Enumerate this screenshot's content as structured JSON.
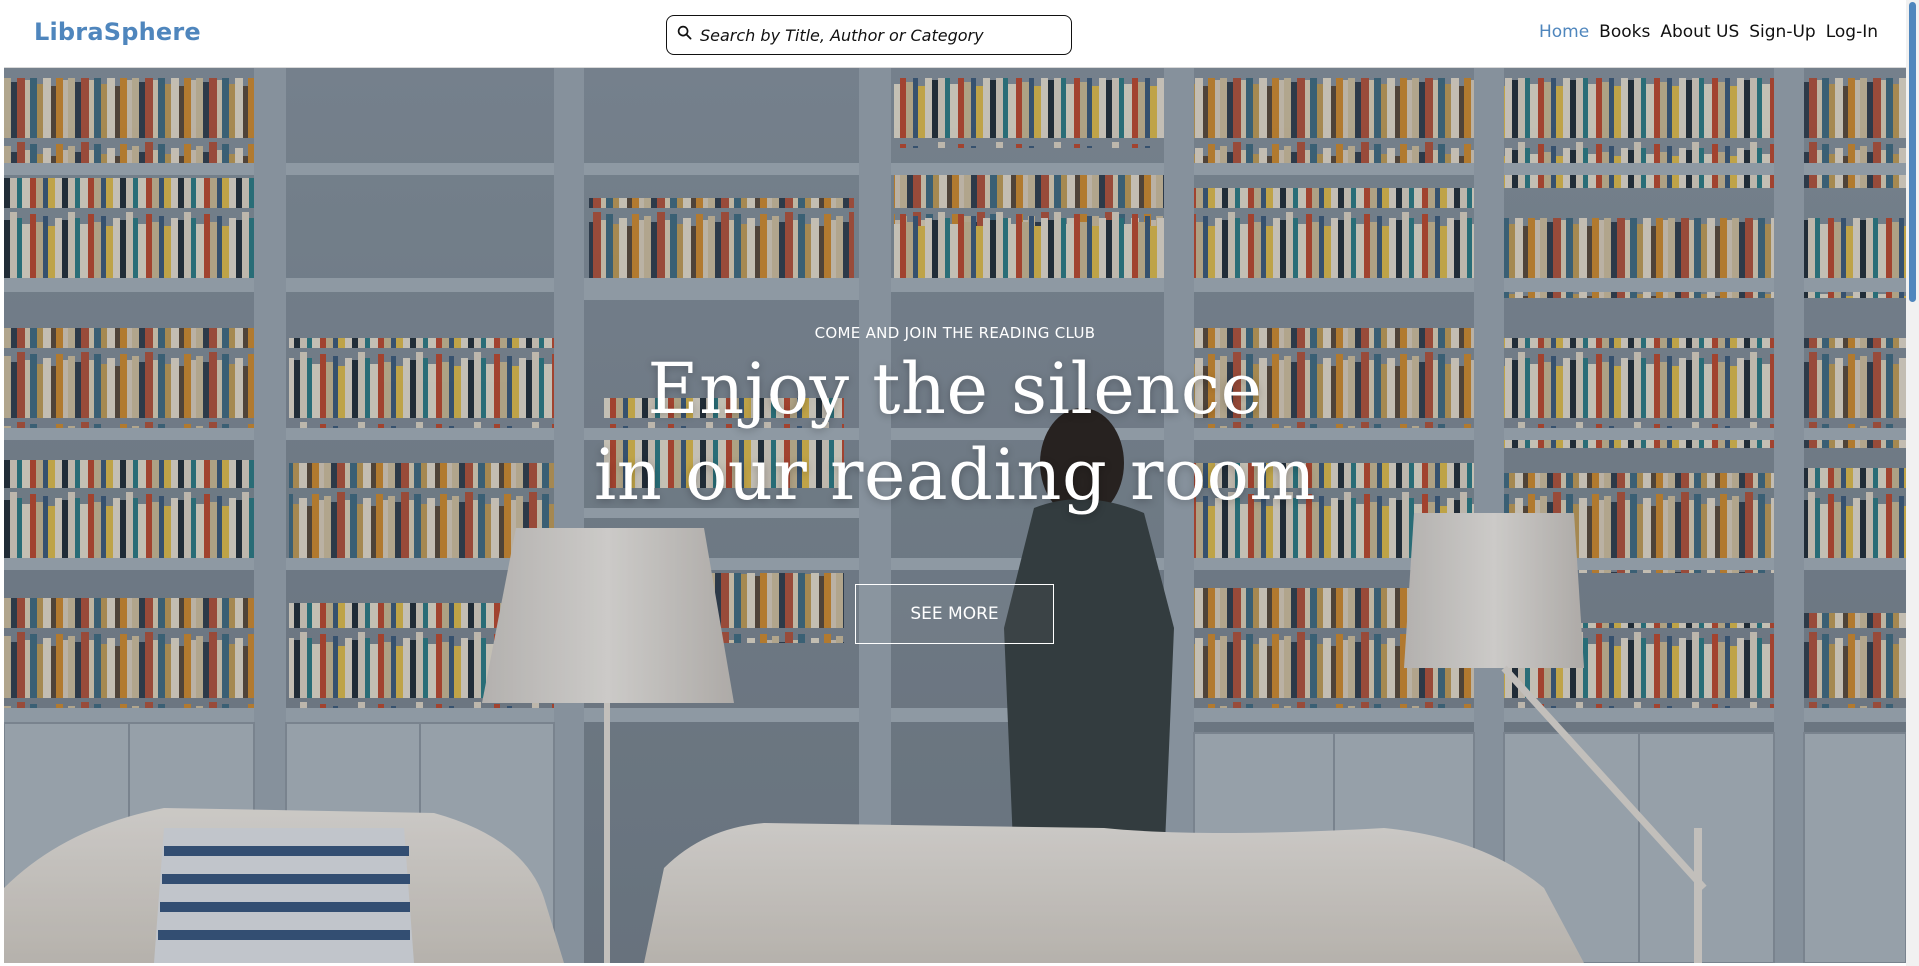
{
  "header": {
    "brand": "LibraSphere",
    "search": {
      "placeholder": "Search by Title, Author or Category",
      "value": ""
    },
    "nav": [
      {
        "label": "Home",
        "active": true
      },
      {
        "label": "Books",
        "active": false
      },
      {
        "label": "About US",
        "active": false
      },
      {
        "label": "Sign-Up",
        "active": false
      },
      {
        "label": "Log-In",
        "active": false
      }
    ]
  },
  "hero": {
    "kicker": "COME AND JOIN THE READING CLUB",
    "headline_line1": "Enjoy the silence",
    "headline_line2": "in our reading room",
    "cta_label": "SEE MORE"
  },
  "icons": {
    "search": "search-icon"
  },
  "colors": {
    "accent": "#4f86bd",
    "nav_text": "#111111",
    "hero_text": "#ffffff"
  }
}
